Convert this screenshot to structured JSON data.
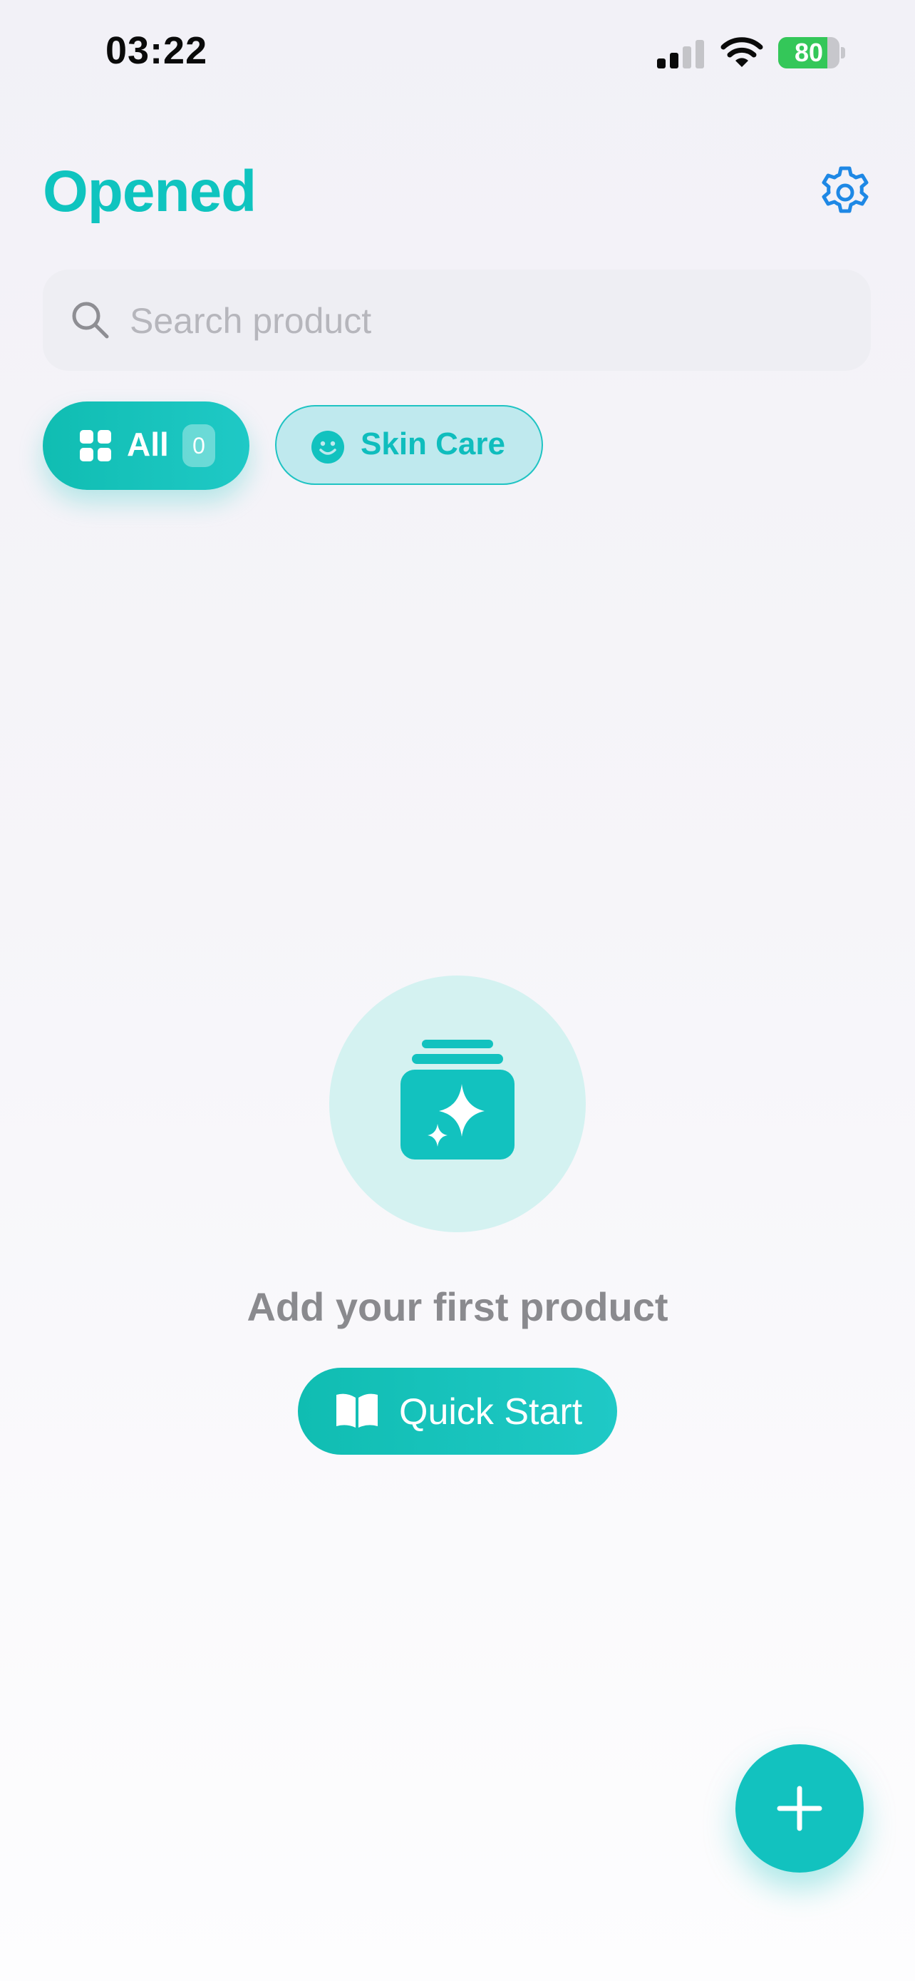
{
  "status_bar": {
    "time": "03:22",
    "battery_percent": 80,
    "battery_label": "80"
  },
  "header": {
    "title": "Opened",
    "settings_icon": "gear-icon"
  },
  "search": {
    "placeholder": "Search product",
    "value": ""
  },
  "filters": [
    {
      "label": "All",
      "count": "0",
      "icon": "grid-icon",
      "selected": true
    },
    {
      "label": "Skin Care",
      "icon": "smiley-icon",
      "selected": false
    }
  ],
  "empty_state": {
    "icon": "stack-sparkle-icon",
    "title": "Add your first product",
    "button_label": "Quick Start",
    "button_icon": "book-icon"
  },
  "fab": {
    "icon": "plus-icon"
  },
  "colors": {
    "accent": "#12c2bf",
    "accent_light": "#d4f2f1",
    "settings_blue": "#1e88e5",
    "battery_green": "#34c759"
  }
}
